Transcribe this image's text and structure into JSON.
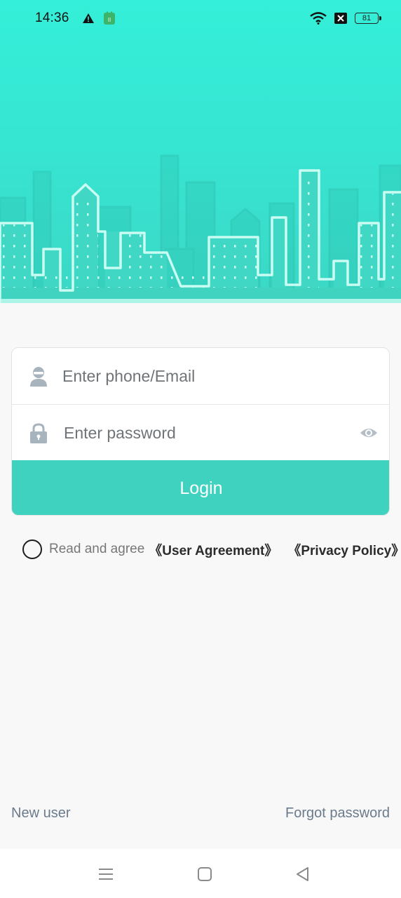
{
  "status": {
    "time": "14:36",
    "battery": "81",
    "icons": [
      "warning-icon",
      "app-notification-icon",
      "wifi-icon",
      "no-sim-icon",
      "battery-icon"
    ]
  },
  "colors": {
    "hero_top": "#34efd9",
    "hero_bottom": "#3cd7c5",
    "accent": "#3fd2bf",
    "background": "#f8f8f8"
  },
  "login": {
    "phone_placeholder": "Enter phone/Email",
    "password_placeholder": "Enter password",
    "login_label": "Login",
    "icons": [
      "user-icon",
      "lock-icon",
      "eye-icon"
    ]
  },
  "agreement": {
    "prefix": "Read and agree",
    "user_agreement": "《User Agreement》",
    "privacy_policy": "《Privacy Policy》"
  },
  "footer": {
    "new_user": "New user",
    "forgot_password": "Forgot password"
  },
  "navbar": {
    "icons": [
      "menu-icon",
      "home-icon",
      "back-icon"
    ]
  }
}
